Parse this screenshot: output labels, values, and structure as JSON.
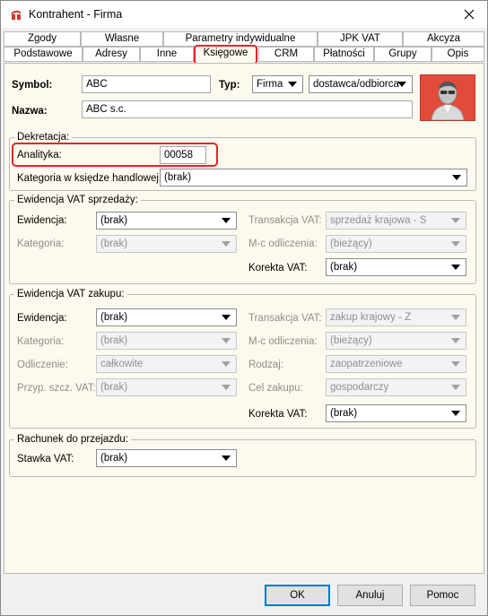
{
  "window": {
    "title": "Kontrahent - Firma"
  },
  "tabs_row1": [
    "Zgody",
    "Własne",
    "Parametry indywidualne",
    "JPK VAT",
    "Akcyza"
  ],
  "tabs_row2": [
    "Podstawowe",
    "Adresy",
    "Inne",
    "Księgowe",
    "CRM",
    "Płatności",
    "Grupy",
    "Opis"
  ],
  "active_tab": "Księgowe",
  "header": {
    "symbol_label": "Symbol:",
    "symbol_value": "ABC",
    "typ_label": "Typ:",
    "typ_value": "Firma",
    "role_value": "dostawca/odbiorca",
    "nazwa_label": "Nazwa:",
    "nazwa_value": "ABC s.c."
  },
  "dekretacja": {
    "title": "Dekretacja:",
    "analityka_label": "Analityka:",
    "analityka_value": "00058",
    "kategoria_label": "Kategoria w księdze handlowej:",
    "kategoria_value": "(brak)"
  },
  "vat_sprzedazy": {
    "title": "Ewidencja VAT sprzedaży:",
    "ewidencja_label": "Ewidencja:",
    "ewidencja_value": "(brak)",
    "kategoria_label": "Kategoria:",
    "kategoria_value": "(brak)",
    "transakcja_label": "Transakcja VAT:",
    "transakcja_value": "sprzedaż krajowa - S",
    "mc_label": "M-c odliczenia:",
    "mc_value": "(bieżący)",
    "korekta_label": "Korekta VAT:",
    "korekta_value": "(brak)"
  },
  "vat_zakupu": {
    "title": "Ewidencja VAT zakupu:",
    "ewidencja_label": "Ewidencja:",
    "ewidencja_value": "(brak)",
    "kategoria_label": "Kategoria:",
    "kategoria_value": "(brak)",
    "odliczenie_label": "Odliczenie:",
    "odliczenie_value": "całkowite",
    "przyp_label": "Przyp. szcz. VAT:",
    "przyp_value": "(brak)",
    "transakcja_label": "Transakcja VAT:",
    "transakcja_value": "zakup krajowy - Z",
    "mc_label": "M-c odliczenia:",
    "mc_value": "(bieżący)",
    "rodzaj_label": "Rodzaj:",
    "rodzaj_value": "zaopatrzeniowe",
    "cel_label": "Cel zakupu:",
    "cel_value": "gospodarczy",
    "korekta_label": "Korekta VAT:",
    "korekta_value": "(brak)"
  },
  "rachunek": {
    "title": "Rachunek do przejazdu:",
    "stawka_label": "Stawka VAT:",
    "stawka_value": "(brak)"
  },
  "buttons": {
    "ok": "OK",
    "anuluj": "Anuluj",
    "pomoc": "Pomoc"
  },
  "colors": {
    "panel": "#fcf9ee",
    "highlight": "#e2262b",
    "avatar_bg": "#e24a3a"
  }
}
